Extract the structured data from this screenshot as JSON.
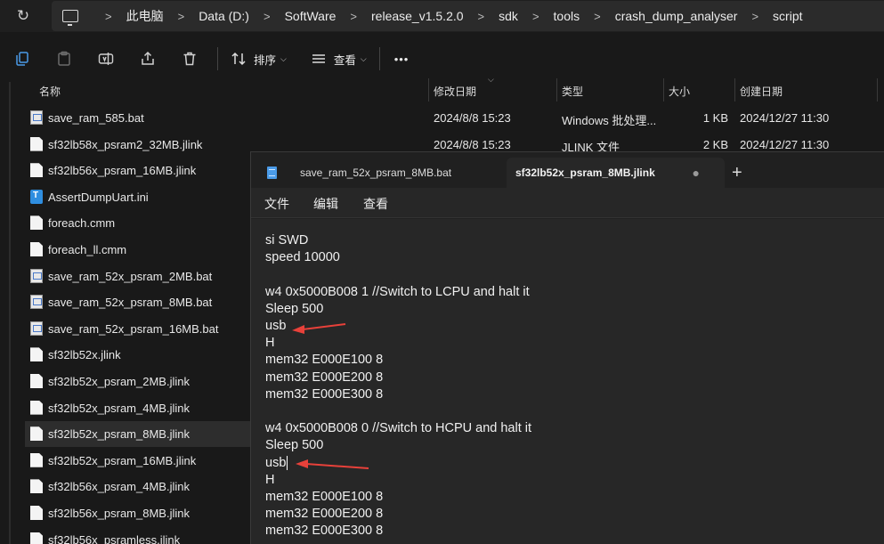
{
  "address_bar": {
    "crumbs": [
      "此电脑",
      "Data (D:)",
      "SoftWare",
      "release_v1.5.2.0",
      "sdk",
      "tools",
      "crash_dump_analyser",
      "script"
    ],
    "separator": ">"
  },
  "toolbar": {
    "sort_label": "排序",
    "view_label": "查看",
    "more_label": "•••"
  },
  "columns": {
    "name": "名称",
    "modified": "修改日期",
    "type": "类型",
    "size": "大小",
    "created": "创建日期"
  },
  "files": [
    {
      "name": "save_ram_585.bat",
      "icon": "bat",
      "modified": "2024/8/8 15:23",
      "type": "Windows 批处理...",
      "size": "1 KB",
      "created": "2024/12/27 11:30"
    },
    {
      "name": "sf32lb58x_psram2_32MB.jlink",
      "icon": "file",
      "modified": "2024/8/8 15:23",
      "type": "JLINK 文件",
      "size": "2 KB",
      "created": "2024/12/27 11:30"
    },
    {
      "name": "sf32lb56x_psram_16MB.jlink",
      "icon": "file"
    },
    {
      "name": "AssertDumpUart.ini",
      "icon": "ini"
    },
    {
      "name": "foreach.cmm",
      "icon": "file"
    },
    {
      "name": "foreach_ll.cmm",
      "icon": "file"
    },
    {
      "name": "save_ram_52x_psram_2MB.bat",
      "icon": "bat"
    },
    {
      "name": "save_ram_52x_psram_8MB.bat",
      "icon": "bat"
    },
    {
      "name": "save_ram_52x_psram_16MB.bat",
      "icon": "bat"
    },
    {
      "name": "sf32lb52x.jlink",
      "icon": "file"
    },
    {
      "name": "sf32lb52x_psram_2MB.jlink",
      "icon": "file"
    },
    {
      "name": "sf32lb52x_psram_4MB.jlink",
      "icon": "file"
    },
    {
      "name": "sf32lb52x_psram_8MB.jlink",
      "icon": "file",
      "selected": true
    },
    {
      "name": "sf32lb52x_psram_16MB.jlink",
      "icon": "file"
    },
    {
      "name": "sf32lb56x_psram_4MB.jlink",
      "icon": "file"
    },
    {
      "name": "sf32lb56x_psram_8MB.jlink",
      "icon": "file"
    },
    {
      "name": "sf32lb56x_psramless.jlink",
      "icon": "file"
    }
  ],
  "notepad": {
    "tabs": [
      {
        "label": "save_ram_52x_psram_8MB.bat",
        "active": false
      },
      {
        "label": "sf32lb52x_psram_8MB.jlink",
        "active": true,
        "unsaved_dot": "●"
      }
    ],
    "new_tab": "+",
    "menu": [
      "文件",
      "编辑",
      "查看"
    ],
    "lines": [
      "si SWD",
      "speed 10000",
      "",
      "w4 0x5000B008 1 //Switch to LCPU and halt it",
      "Sleep 500",
      "usb",
      "H",
      "mem32 E000E100 8",
      "mem32 E000E200 8",
      "mem32 E000E300 8",
      "",
      "w4 0x5000B008 0 //Switch to HCPU and halt it",
      "Sleep 500",
      "usb",
      "H",
      "mem32 E000E100 8",
      "mem32 E000E200 8",
      "mem32 E000E300 8"
    ],
    "arrow_color": "#e8413a"
  }
}
